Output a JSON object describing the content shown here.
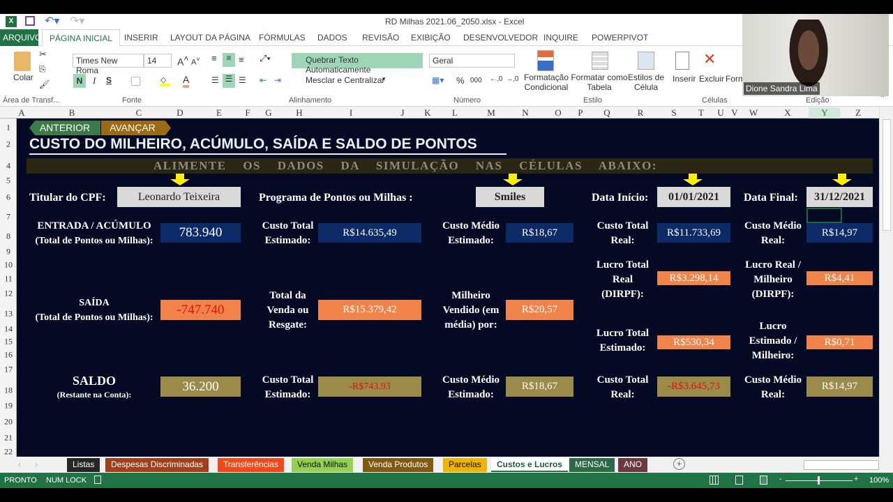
{
  "window": {
    "title": "RD Milhas 2021.06_2050.xlsx - Excel"
  },
  "ribbon_tabs": [
    {
      "label": "ARQUIVO"
    },
    {
      "label": "PÁGINA INICIAL"
    },
    {
      "label": "INSERIR"
    },
    {
      "label": "LAYOUT DA PÁGINA"
    },
    {
      "label": "FÓRMULAS"
    },
    {
      "label": "DADOS"
    },
    {
      "label": "REVISÃO"
    },
    {
      "label": "EXIBIÇÃO"
    },
    {
      "label": "DESENVOLVEDOR"
    },
    {
      "label": "INQUIRE"
    },
    {
      "label": "POWERPIVOT"
    }
  ],
  "ribbon": {
    "paste": "Colar",
    "font_name": "Times New Roma",
    "font_size": "14",
    "bold": "N",
    "italic": "I",
    "underline": "S",
    "wrap_text": "Quebrar Texto Automaticamente",
    "merge": "Mesclar e Centralizar",
    "number_format": "Geral",
    "percent": "%",
    "thousands": "000",
    "cond_format": [
      "Formatação",
      "Condicional"
    ],
    "format_table": [
      "Formatar como",
      "Tabela"
    ],
    "cell_styles": [
      "Estilos de",
      "Célula"
    ],
    "insert": "Inserir",
    "delete": "Excluir",
    "format": "Form",
    "groups": [
      "Área de Transf...",
      "Fonte",
      "Alinhamento",
      "Número",
      "Estilo",
      "Células",
      "Edição"
    ]
  },
  "webcam": {
    "name": "Dione Sandra Lima"
  },
  "columns": [
    "A",
    "B",
    "C",
    "D",
    "E",
    "F",
    "G",
    "H",
    "I",
    "J",
    "K",
    "L",
    "M",
    "N",
    "O",
    "P",
    "Q",
    "R",
    "S",
    "T",
    "U",
    "V",
    "W",
    "X",
    "Y",
    "Z"
  ],
  "selected_column": "Y",
  "rows": [
    "1",
    "2",
    "4",
    "5",
    "6",
    "7",
    "8",
    "9",
    "10",
    "11",
    "12",
    "13",
    "14",
    "15",
    "16",
    "17",
    "18",
    "19",
    "20",
    "21",
    "22"
  ],
  "sheet": {
    "nav_prev": "ANTERIOR",
    "nav_next": "AVANÇAR",
    "title": "CUSTO DO MILHEIRO, ACÚMULO, SAÍDA E SALDO DE PONTOS",
    "banner": "ALIMENTE OS DADOS DA SIMULAÇÃO NAS CÉLULAS ABAIXO:",
    "titular_label": "Titular do CPF:",
    "titular_value": "Leonardo Teixeira",
    "programa_label": "Programa de Pontos ou Milhas :",
    "programa_value": "Smiles",
    "data_inicio_label": "Data Início:",
    "data_inicio_value": "01/01/2021",
    "data_final_label": "Data Final:",
    "data_final_value": "31/12/2021",
    "entrada_label": "ENTRADA / ACÚMULO",
    "entrada_sub": "(Total de Pontos ou Milhas):",
    "entrada_value": "783.940",
    "custo_total_est_label": [
      "Custo Total",
      "Estimado:"
    ],
    "custo_total_est_value": "R$14.635,49",
    "custo_medio_est_label": [
      "Custo Médio",
      "Estimado:"
    ],
    "custo_medio_est_value": "R$18,67",
    "custo_total_real_label": [
      "Custo Total",
      "Real:"
    ],
    "custo_total_real_value": "R$11.733,69",
    "custo_medio_real_label": [
      "Custo Médio",
      "Real:"
    ],
    "custo_medio_real_value": "R$14,97",
    "lucro_total_real_label": [
      "Lucro Total",
      "Real",
      "(DIRPF):"
    ],
    "lucro_total_real_value": "R$3.298,14",
    "lucro_real_milheiro_label": [
      "Lucro Real /",
      "Milheiro",
      "(DIRPF):"
    ],
    "lucro_real_milheiro_value": "R$4,41",
    "saida_label": "SAÍDA",
    "saida_sub": "(Total de Pontos ou Milhas):",
    "saida_value": "-747.740",
    "total_venda_label": [
      "Total da",
      "Venda ou",
      "Resgate:"
    ],
    "total_venda_value": "R$15.379,42",
    "milheiro_vendido_label": [
      "Milheiro",
      "Vendido (em",
      "média) por:"
    ],
    "milheiro_vendido_value": "R$20,57",
    "lucro_total_est_label": [
      "Lucro Total",
      "Estimado:"
    ],
    "lucro_total_est_value": "R$530,34",
    "lucro_est_milheiro_label": [
      "Lucro",
      "Estimado /",
      "Milheiro:"
    ],
    "lucro_est_milheiro_value": "R$0,71",
    "saldo_label": "SALDO",
    "saldo_sub": "(Restante na Conta):",
    "saldo_value": "36.200",
    "saldo_custo_total_label": [
      "Custo Total",
      "Estimado:"
    ],
    "saldo_custo_total_value": "-R$743.93",
    "saldo_custo_medio_label": [
      "Custo Médio",
      "Estimado:"
    ],
    "saldo_custo_medio_value": "R$18,67",
    "saldo_custo_real_label": [
      "Custo Total",
      "Real:"
    ],
    "saldo_custo_real_value": "-R$3.645,73",
    "saldo_custo_medio_real_label": [
      "Custo Médio",
      "Real:"
    ],
    "saldo_custo_medio_real_value": "R$14,97"
  },
  "sheet_tabs": [
    {
      "label": "Listas",
      "color": "#262626",
      "text": "#ffffff"
    },
    {
      "label": "Despesas Discriminadas",
      "color": "#a0401a",
      "text": "#ffffff"
    },
    {
      "label": "Transferências",
      "color": "#f04a1a",
      "text": "#ffffff"
    },
    {
      "label": "Venda Milhas",
      "color": "#92d050",
      "text": "#111111"
    },
    {
      "label": "Venda Produtos",
      "color": "#7f5a10",
      "text": "#ffffff"
    },
    {
      "label": "Parcelas",
      "color": "#f0b400",
      "text": "#111111"
    },
    {
      "label": "Custos e Lucros",
      "color": "#ffffff",
      "text": "#1e5a3e",
      "active": true
    },
    {
      "label": "MENSAL",
      "color": "#2f6a48",
      "text": "#ffffff"
    },
    {
      "label": "ANO",
      "color": "#6b3b40",
      "text": "#ffffff"
    }
  ],
  "status": {
    "ready": "PRONTO",
    "numlock": "NUM LOCK",
    "zoom": "100%"
  },
  "colors": {
    "excel_green": "#217346",
    "sheet_bg": "#050a24",
    "navy_cell": "#0b2a66",
    "orange_cell": "#f0834a",
    "olive_cell": "#9a8b4a",
    "negative_red": "#e01010"
  }
}
